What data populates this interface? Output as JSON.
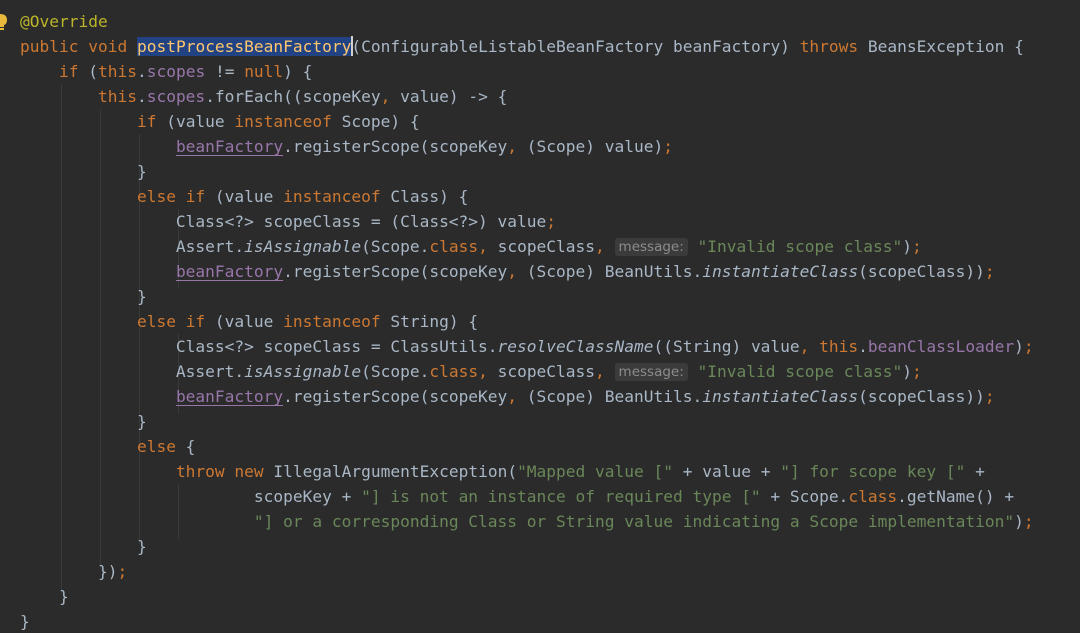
{
  "editor": {
    "theme": "dark",
    "colors": {
      "background": "#2b2b2b",
      "keyword": "#cc7832",
      "annotation": "#bbb529",
      "field": "#9876aa",
      "string": "#6a8759",
      "method_declaration": "#ffc66d",
      "plain": "#a9b7c6",
      "selection": "#214283"
    },
    "gutter_icon": "intention-bulb-icon",
    "lines": [
      [
        {
          "t": "@Override",
          "c": "ann"
        }
      ],
      [
        {
          "t": "public",
          "c": "kw"
        },
        {
          "t": " "
        },
        {
          "t": "void",
          "c": "kw"
        },
        {
          "t": " "
        },
        {
          "t": "postProcessBeanFactory",
          "c": "mth sel"
        },
        {
          "caret": true
        },
        {
          "t": "(ConfigurableListableBeanFactory beanFactory) "
        },
        {
          "t": "throws",
          "c": "kw"
        },
        {
          "t": " BeansException {"
        }
      ],
      [
        {
          "t": "    "
        },
        {
          "t": "if",
          "c": "kw"
        },
        {
          "t": " ("
        },
        {
          "t": "this",
          "c": "kw"
        },
        {
          "t": "."
        },
        {
          "t": "scopes",
          "c": "fld"
        },
        {
          "t": " != "
        },
        {
          "t": "null",
          "c": "kw"
        },
        {
          "t": ") {"
        }
      ],
      [
        {
          "t": "        "
        },
        {
          "t": "this",
          "c": "kw"
        },
        {
          "t": "."
        },
        {
          "t": "scopes",
          "c": "fld"
        },
        {
          "t": ".forEach((scopeKey"
        },
        {
          "t": ",",
          "c": "kw"
        },
        {
          "t": " value) -> {"
        }
      ],
      [
        {
          "t": "            "
        },
        {
          "t": "if",
          "c": "kw"
        },
        {
          "t": " (value "
        },
        {
          "t": "instanceof",
          "c": "kw"
        },
        {
          "t": " Scope) {"
        }
      ],
      [
        {
          "t": "                "
        },
        {
          "t": "beanFactory",
          "c": "fld ul"
        },
        {
          "t": ".registerScope(scopeKey"
        },
        {
          "t": ",",
          "c": "kw"
        },
        {
          "t": " (Scope) value)"
        },
        {
          "t": ";",
          "c": "kw"
        }
      ],
      [
        {
          "t": "            }"
        }
      ],
      [
        {
          "t": "            "
        },
        {
          "t": "else",
          "c": "kw"
        },
        {
          "t": " "
        },
        {
          "t": "if",
          "c": "kw"
        },
        {
          "t": " (value "
        },
        {
          "t": "instanceof",
          "c": "kw"
        },
        {
          "t": " Class) {"
        }
      ],
      [
        {
          "t": "                Class<?> scopeClass = (Class<?>) value"
        },
        {
          "t": ";",
          "c": "kw"
        }
      ],
      [
        {
          "t": "                Assert."
        },
        {
          "t": "isAssignable",
          "c": "st"
        },
        {
          "t": "(Scope."
        },
        {
          "t": "class",
          "c": "kw"
        },
        {
          "t": ", ",
          "c": "kw"
        },
        {
          "t": "scopeClass"
        },
        {
          "t": ",",
          "c": "kw"
        },
        {
          "t": " "
        },
        {
          "hint": "message:"
        },
        {
          "t": " "
        },
        {
          "t": "\"Invalid scope class\"",
          "c": "str"
        },
        {
          "t": ")"
        },
        {
          "t": ";",
          "c": "kw"
        }
      ],
      [
        {
          "t": "                "
        },
        {
          "t": "beanFactory",
          "c": "fld ul"
        },
        {
          "t": ".registerScope(scopeKey"
        },
        {
          "t": ",",
          "c": "kw"
        },
        {
          "t": " (Scope) BeanUtils."
        },
        {
          "t": "instantiateClass",
          "c": "st"
        },
        {
          "t": "(scopeClass))"
        },
        {
          "t": ";",
          "c": "kw"
        }
      ],
      [
        {
          "t": "            }"
        }
      ],
      [
        {
          "t": "            "
        },
        {
          "t": "else",
          "c": "kw"
        },
        {
          "t": " "
        },
        {
          "t": "if",
          "c": "kw"
        },
        {
          "t": " (value "
        },
        {
          "t": "instanceof",
          "c": "kw"
        },
        {
          "t": " String) {"
        }
      ],
      [
        {
          "t": "                Class<?> scopeClass = ClassUtils."
        },
        {
          "t": "resolveClassName",
          "c": "st"
        },
        {
          "t": "((String) value"
        },
        {
          "t": ",",
          "c": "kw"
        },
        {
          "t": " "
        },
        {
          "t": "this",
          "c": "kw"
        },
        {
          "t": "."
        },
        {
          "t": "beanClassLoader",
          "c": "fld"
        },
        {
          "t": ")"
        },
        {
          "t": ";",
          "c": "kw"
        }
      ],
      [
        {
          "t": "                Assert."
        },
        {
          "t": "isAssignable",
          "c": "st"
        },
        {
          "t": "(Scope."
        },
        {
          "t": "class",
          "c": "kw"
        },
        {
          "t": ", ",
          "c": "kw"
        },
        {
          "t": "scopeClass"
        },
        {
          "t": ",",
          "c": "kw"
        },
        {
          "t": " "
        },
        {
          "hint": "message:"
        },
        {
          "t": " "
        },
        {
          "t": "\"Invalid scope class\"",
          "c": "str"
        },
        {
          "t": ")"
        },
        {
          "t": ";",
          "c": "kw"
        }
      ],
      [
        {
          "t": "                "
        },
        {
          "t": "beanFactory",
          "c": "fld ul"
        },
        {
          "t": ".registerScope(scopeKey"
        },
        {
          "t": ",",
          "c": "kw"
        },
        {
          "t": " (Scope) BeanUtils."
        },
        {
          "t": "instantiateClass",
          "c": "st"
        },
        {
          "t": "(scopeClass))"
        },
        {
          "t": ";",
          "c": "kw"
        }
      ],
      [
        {
          "t": "            }"
        }
      ],
      [
        {
          "t": "            "
        },
        {
          "t": "else",
          "c": "kw"
        },
        {
          "t": " {"
        }
      ],
      [
        {
          "t": "                "
        },
        {
          "t": "throw",
          "c": "kw"
        },
        {
          "t": " "
        },
        {
          "t": "new",
          "c": "kw"
        },
        {
          "t": " IllegalArgumentException("
        },
        {
          "t": "\"Mapped value [\"",
          "c": "str"
        },
        {
          "t": " + value + "
        },
        {
          "t": "\"] for scope key [\"",
          "c": "str"
        },
        {
          "t": " +"
        }
      ],
      [
        {
          "t": "                        scopeKey + "
        },
        {
          "t": "\"] is not an instance of required type [\"",
          "c": "str"
        },
        {
          "t": " + Scope."
        },
        {
          "t": "class",
          "c": "kw"
        },
        {
          "t": ".getName() +"
        }
      ],
      [
        {
          "t": "                        "
        },
        {
          "t": "\"] or a corresponding Class or String value indicating a Scope implementation\"",
          "c": "str"
        },
        {
          "t": ")"
        },
        {
          "t": ";",
          "c": "kw"
        }
      ],
      [
        {
          "t": "            }"
        }
      ],
      [
        {
          "t": "        })"
        },
        {
          "t": ";",
          "c": "kw"
        }
      ],
      [
        {
          "t": "    }"
        }
      ],
      [
        {
          "t": "}"
        }
      ]
    ]
  }
}
